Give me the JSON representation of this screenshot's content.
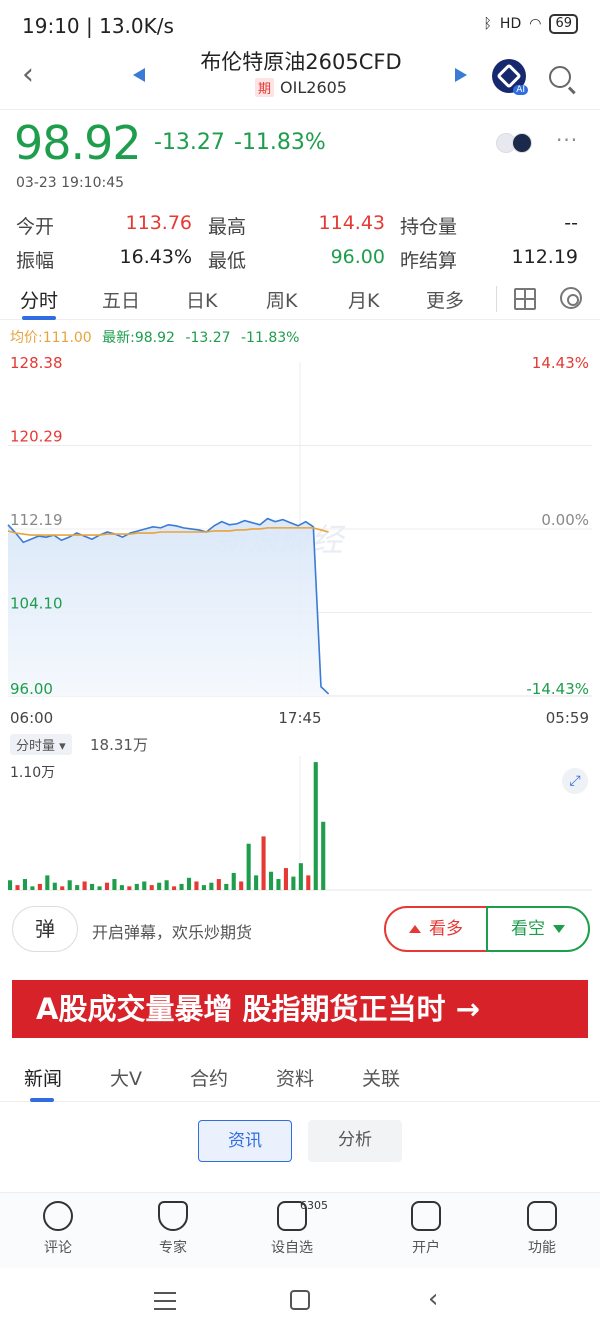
{
  "status_bar": {
    "time": "19:10 | 13.0K/s",
    "battery": "69",
    "network": "HD"
  },
  "nav": {
    "title": "布伦特原油2605CFD",
    "tag": "期",
    "subtitle": "OIL2605"
  },
  "quote": {
    "price": "98.92",
    "change": "-13.27",
    "change_pct": "-11.83%",
    "timestamp": "03-23 19:10:45",
    "stats": [
      {
        "label": "今开",
        "value": "113.76",
        "color": "#e53935"
      },
      {
        "label": "最高",
        "value": "114.43",
        "color": "#e53935"
      },
      {
        "label": "持仓量",
        "value": "--",
        "color": "#222222"
      },
      {
        "label": "振幅",
        "value": "16.43%",
        "color": "#222222"
      },
      {
        "label": "最低",
        "value": "96.00",
        "color": "#1e9e4c"
      },
      {
        "label": "昨结算",
        "value": "112.19",
        "color": "#222222"
      }
    ]
  },
  "tabs": [
    "分时",
    "五日",
    "日K",
    "周K",
    "月K",
    "更多"
  ],
  "legend": {
    "avg": "均价:111.00",
    "latest": "最新:98.92",
    "chg": "-13.27",
    "pct": "-11.83%"
  },
  "chart_data": {
    "type": "line",
    "y_left_ticks": [
      "128.38",
      "120.29",
      "112.19",
      "104.10",
      "96.00"
    ],
    "y_right_ticks": [
      "14.43%",
      "0.00%",
      "-14.43%"
    ],
    "x_ticks": [
      "06:00",
      "17:45",
      "05:59"
    ],
    "ylim": [
      96.0,
      128.38
    ],
    "base": 112.19,
    "series": [
      {
        "name": "price",
        "color": "#3a7bd5",
        "values": [
          112.6,
          111.8,
          110.9,
          111.2,
          111.5,
          111.4,
          111.6,
          111.1,
          111.4,
          111.8,
          111.5,
          111.2,
          111.6,
          111.9,
          111.7,
          111.4,
          111.8,
          112.0,
          112.2,
          112.4,
          112.3,
          112.6,
          112.5,
          112.3,
          112.2,
          112.1,
          111.9,
          112.5,
          112.9,
          112.6,
          112.7,
          113.0,
          112.8,
          112.6,
          113.2,
          112.9,
          113.1,
          112.8,
          112.5,
          112.9,
          112.4,
          96.9,
          96.2
        ]
      },
      {
        "name": "avg",
        "color": "#e8a33c",
        "values": [
          112.0,
          111.8,
          111.7,
          111.6,
          111.6,
          111.6,
          111.6,
          111.6,
          111.6,
          111.6,
          111.6,
          111.6,
          111.6,
          111.7,
          111.7,
          111.7,
          111.7,
          111.8,
          111.8,
          111.8,
          111.9,
          111.9,
          111.9,
          111.9,
          111.9,
          111.9,
          111.9,
          112.0,
          112.0,
          112.0,
          112.1,
          112.1,
          112.2,
          112.2,
          112.3,
          112.3,
          112.3,
          112.3,
          112.3,
          112.3,
          112.3,
          112.1,
          111.9
        ]
      }
    ],
    "watermark": "新浪财经"
  },
  "volume": {
    "label": "分时量",
    "total": "18.31万",
    "max_label": "1.10万",
    "max": 11000,
    "values": [
      800,
      400,
      900,
      300,
      500,
      1200,
      600,
      300,
      800,
      400,
      700,
      500,
      300,
      600,
      900,
      400,
      300,
      500,
      700,
      400,
      600,
      800,
      300,
      500,
      1000,
      700,
      400,
      600,
      900,
      500,
      1400,
      700,
      3800,
      1200,
      4400,
      1500,
      900,
      1800,
      1100,
      2200,
      1200,
      10500,
      5600
    ]
  },
  "danmu": {
    "button": "弹",
    "text": "开启弹幕，欢乐炒期货"
  },
  "actions": {
    "bull": "看多",
    "bear": "看空"
  },
  "banner": "A股成交量暴增 股指期货正当时 →",
  "news_tabs": [
    "新闻",
    "大V",
    "合约",
    "资料",
    "关联"
  ],
  "sub_tabs": [
    "资讯",
    "分析"
  ],
  "bottom_nav": [
    {
      "label": "评论",
      "icon": "comment-icon"
    },
    {
      "label": "专家",
      "icon": "expert-icon"
    },
    {
      "label": "设自选",
      "icon": "favorite-icon",
      "badge": "6305"
    },
    {
      "label": "开户",
      "icon": "open-account-icon"
    },
    {
      "label": "功能",
      "icon": "menu-icon"
    }
  ]
}
